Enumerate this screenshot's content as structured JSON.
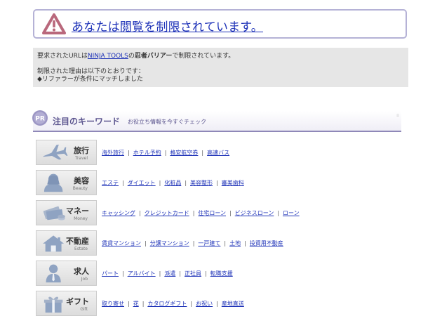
{
  "alert": {
    "title": "あなたは閲覧を制限されています。",
    "icon": "warning-triangle-icon",
    "color": "#1f33b8"
  },
  "info": {
    "line1_prefix": "要求されたURLは",
    "line1_link": "NINJA TOOLS",
    "line1_mid": "の",
    "line1_bold": "忍者バリアー",
    "line1_suffix": "で制限されています。",
    "line2": "制限された理由は以下のとおりです：",
    "line3": "◆リファラーが条件にマッチしました"
  },
  "keywords": {
    "badge": "PR",
    "title": "注目のキーワード",
    "subtitle": "お役立ち情報を今すぐチェック"
  },
  "categories": [
    {
      "jp": "旅行",
      "en": "Travel",
      "icon": "airplane-icon",
      "links": [
        "海外旅行",
        "ホテル予約",
        "格安航空券",
        "高速バス"
      ]
    },
    {
      "jp": "美容",
      "en": "Beauty",
      "icon": "woman-silhouette-icon",
      "links": [
        "エステ",
        "ダイエット",
        "化粧品",
        "美容整形",
        "審美歯科"
      ]
    },
    {
      "jp": "マネー",
      "en": "Money",
      "icon": "money-icon",
      "links": [
        "キャッシング",
        "クレジットカード",
        "住宅ローン",
        "ビジネスローン",
        "ローン"
      ]
    },
    {
      "jp": "不動産",
      "en": "Estate",
      "icon": "house-icon",
      "links": [
        "賃貸マンション",
        "分譲マンション",
        "一戸建て",
        "土地",
        "投資用不動産"
      ]
    },
    {
      "jp": "求人",
      "en": "Job",
      "icon": "person-icon",
      "links": [
        "パート",
        "アルバイト",
        "派遣",
        "正社員",
        "転職支援"
      ]
    },
    {
      "jp": "ギフト",
      "en": "Gift",
      "icon": "gift-box-icon",
      "links": [
        "取り寄せ",
        "花",
        "カタログギフト",
        "お祝い",
        "産地直送"
      ]
    }
  ]
}
